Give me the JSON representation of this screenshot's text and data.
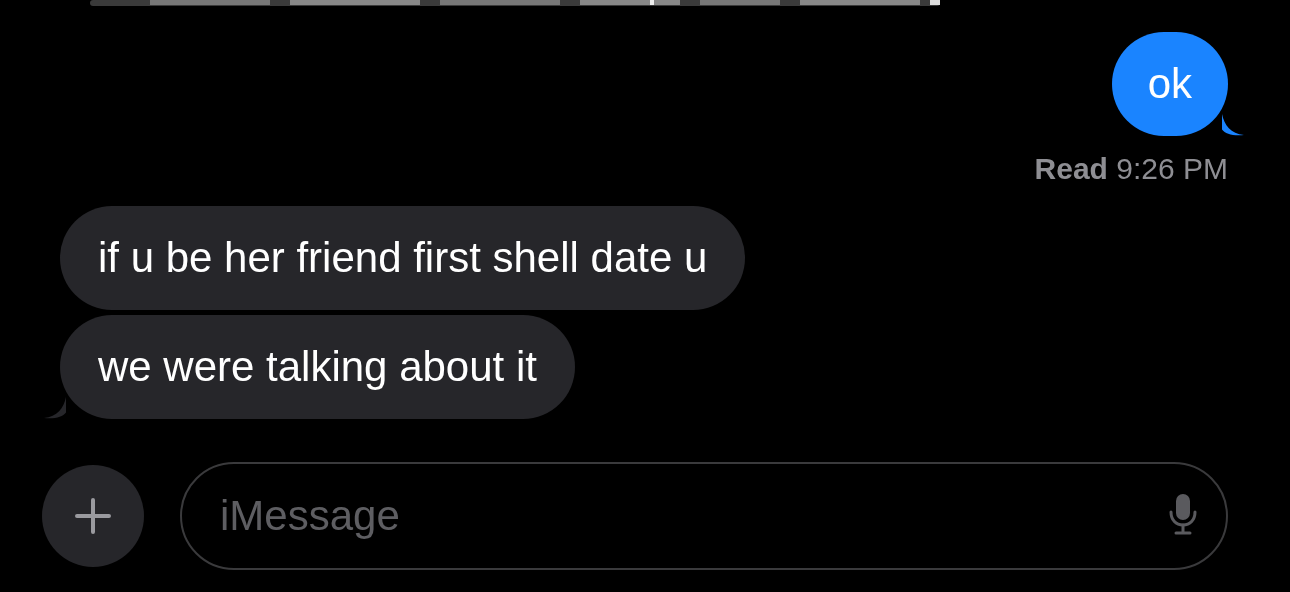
{
  "messages": [
    {
      "kind": "sent",
      "text": "ok",
      "tail": true
    },
    {
      "kind": "receipt",
      "text": "**Read** 9:26 PM"
    },
    {
      "kind": "received",
      "text": "if u be her friend first shell date u",
      "tail": false
    },
    {
      "kind": "received",
      "text": "we were talking about it",
      "tail": true
    }
  ],
  "composer": {
    "placeholder": "iMessage"
  }
}
